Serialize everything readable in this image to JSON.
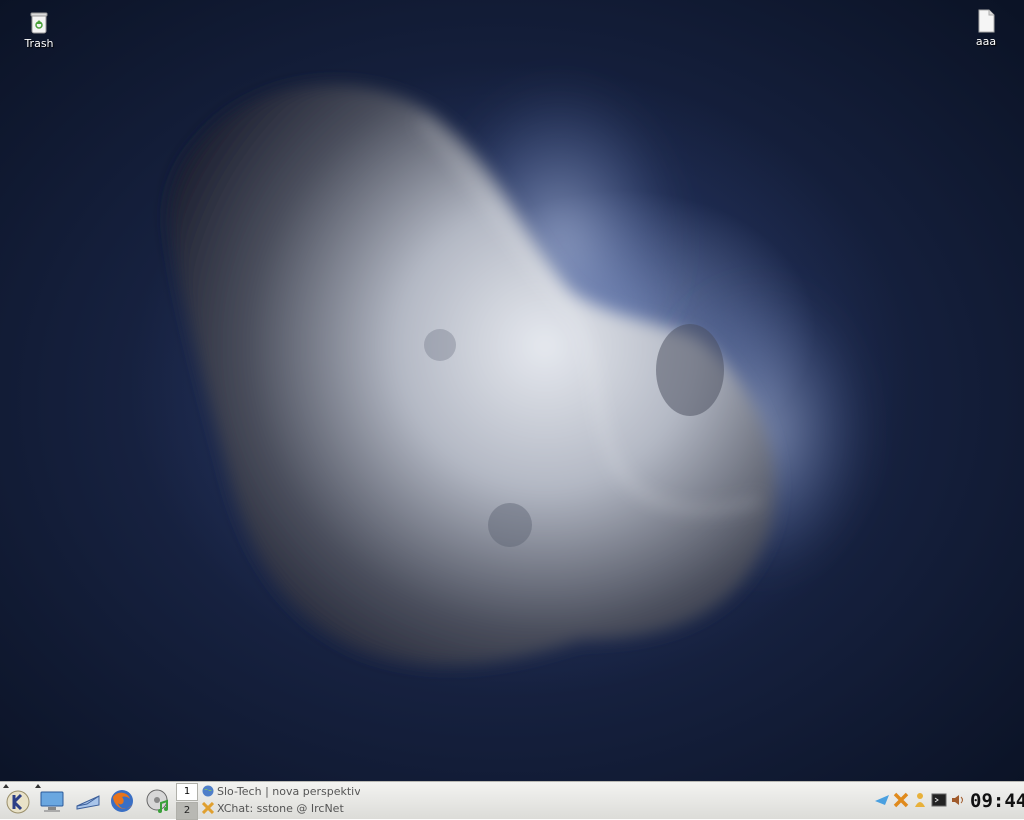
{
  "desktop": {
    "icons": [
      {
        "label": "Trash",
        "icon": "trash-icon"
      },
      {
        "label": "aaa",
        "icon": "file-icon"
      }
    ]
  },
  "taskbar": {
    "launchers": [
      {
        "name": "kde-menu-icon"
      },
      {
        "name": "computer-icon"
      },
      {
        "name": "mail-icon"
      },
      {
        "name": "firefox-icon"
      },
      {
        "name": "media-player-icon"
      }
    ],
    "pager": {
      "desktops": [
        "1",
        "2"
      ],
      "active": "1"
    },
    "tasks": [
      {
        "title": "Slo-Tech | nova perspektiv",
        "fade": "a",
        "icon": "globe-icon"
      },
      {
        "title": "XChat: sstone @ IrcNet",
        "fade": "",
        "icon": "xchat-icon"
      }
    ],
    "tray": [
      "arrow-icon",
      "x-icon",
      "user-icon",
      "terminal-icon",
      "volume-icon"
    ],
    "clock": {
      "time": "09:44"
    }
  }
}
